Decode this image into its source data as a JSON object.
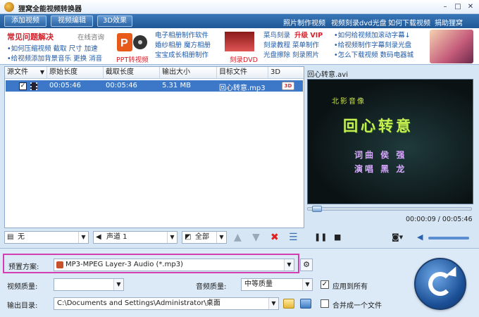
{
  "window": {
    "title": "狸窝全能视频转换器"
  },
  "toolbar": {
    "add_video": "添加视频",
    "edit_video": "视频编辑",
    "effect_3d": "3D效果",
    "links": [
      "照片制作视频",
      "视频刻录dvd光盘",
      "如何下载视频",
      "捐助狸窝"
    ]
  },
  "banner": {
    "faq_title": "常见问题解决",
    "faq_consult": "在线咨询",
    "faq_line1": "•如何压缩视频  截取  尺寸  加速",
    "faq_line2": "•给视频添加背景音乐  更换  消音",
    "ppt_label": "PPT转视频",
    "col1": [
      "电子相册制作软件",
      "婚纱相册  魔方相册",
      "宝宝成长相册制作"
    ],
    "dvd_label": "刻录DVD",
    "col2_line1_a": "菜鸟刻录",
    "col2_line1_b": "升级 VIP",
    "col2_line2": "刻录教程  菜单制作",
    "col2_line3": "光盘擦除  刻录照片",
    "col3": [
      "•如何给视频加滚动字幕↓",
      "•给视频制作字幕刻录光盘",
      "•怎么下载视频  数码电器城"
    ]
  },
  "table": {
    "headers": [
      "源文件",
      "原始长度",
      "截取长度",
      "输出大小",
      "目标文件",
      "3D"
    ],
    "rows": [
      {
        "original_length": "00:05:46",
        "clip_length": "00:05:46",
        "output_size": "5.31 MB",
        "target_file": "回心转意.mp3",
        "checked": true
      }
    ]
  },
  "subbar": {
    "subtitle_select": "无",
    "audio_track_select": "声道 1",
    "select_all": "全部"
  },
  "preview": {
    "filename": "回心转意.avi",
    "video_small_text": "北影音像",
    "video_title": "回心转意",
    "credit_line1": "词曲  侯  强",
    "credit_line2": "演唱  黑  龙",
    "time_current": "00:00:09",
    "time_total": "00:05:46",
    "time_display": "00:00:09 / 00:05:46",
    "progress_fraction": 0.026
  },
  "settings": {
    "preset_label": "预置方案:",
    "preset_value": "MP3-MPEG Layer-3 Audio (*.mp3)",
    "video_quality_label": "视频质量:",
    "video_quality_value": "",
    "audio_quality_label": "音频质量:",
    "audio_quality_value": "中等质量",
    "apply_all_label": "应用到所有",
    "apply_all_checked": true,
    "output_dir_label": "输出目录:",
    "output_dir_value": "C:\\Documents and Settings\\Administrator\\桌面",
    "merge_label": "合并成一个文件",
    "merge_checked": false
  },
  "colors": {
    "toolbar_bg": "#2b66a8",
    "selected_row": "#3d78c8",
    "highlight_frame": "#d33fb3",
    "red_text": "#d6202a",
    "link_blue": "#1f5aa8"
  }
}
